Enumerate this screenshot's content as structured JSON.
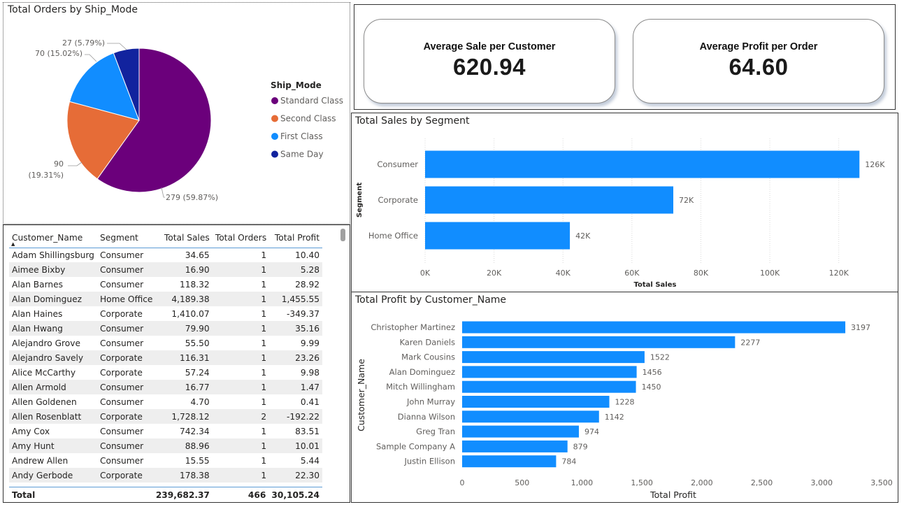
{
  "pie": {
    "title": "Total Orders by Ship_Mode",
    "legend_title": "Ship_Mode",
    "chart_data": {
      "type": "pie",
      "title": "Total Orders by Ship_Mode",
      "slices": [
        {
          "name": "Standard Class",
          "value": 279,
          "label": "279 (59.87%)",
          "color": "#6b007b"
        },
        {
          "name": "Second Class",
          "value": 90,
          "label": "90 (19.31%)",
          "color": "#e66c37"
        },
        {
          "name": "First Class",
          "value": 70,
          "label": "70 (15.02%)",
          "color": "#118dff"
        },
        {
          "name": "Same Day",
          "value": 27,
          "label": "27 (5.79%)",
          "color": "#12239e"
        }
      ]
    }
  },
  "cards": {
    "card1": {
      "label": "Average Sale per Customer",
      "value": "620.94"
    },
    "card2": {
      "label": "Average Profit per Order",
      "value": "64.60"
    }
  },
  "segment_chart": {
    "title": "Total Sales by Segment",
    "chart_data": {
      "type": "bar",
      "orientation": "horizontal",
      "title": "Total Sales by Segment",
      "xlabel": "Total Sales",
      "ylabel": "Segment",
      "categories": [
        "Consumer",
        "Corporate",
        "Home Office"
      ],
      "values": [
        126000,
        72000,
        42000
      ],
      "data_labels": [
        "126K",
        "72K",
        "42K"
      ],
      "xlim": [
        0,
        130000
      ],
      "xticks": [
        0,
        20000,
        40000,
        60000,
        80000,
        100000,
        120000
      ],
      "xtick_labels": [
        "0K",
        "20K",
        "40K",
        "60K",
        "80K",
        "100K",
        "120K"
      ],
      "color": "#118dff",
      "grid": true
    }
  },
  "profit_chart": {
    "title": "Total Profit by Customer_Name",
    "chart_data": {
      "type": "bar",
      "orientation": "horizontal",
      "title": "Total Profit by Customer_Name",
      "xlabel": "Total Profit",
      "ylabel": "Customer_Name",
      "categories": [
        "Christopher Martinez",
        "Karen Daniels",
        "Mark Cousins",
        "Alan Dominguez",
        "Mitch Willingham",
        "John Murray",
        "Dianna Wilson",
        "Greg Tran",
        "Sample Company A",
        "Justin Ellison"
      ],
      "values": [
        3197,
        2277,
        1522,
        1456,
        1450,
        1228,
        1142,
        974,
        879,
        784
      ],
      "data_labels": [
        "3197",
        "2277",
        "1522",
        "1456",
        "1450",
        "1228",
        "1142",
        "974",
        "879",
        "784"
      ],
      "xlim": [
        0,
        3500
      ],
      "xticks": [
        0,
        500,
        1000,
        1500,
        2000,
        2500,
        3000,
        3500
      ],
      "xtick_labels": [
        "0",
        "500",
        "1,000",
        "1,500",
        "2,000",
        "2,500",
        "3,000",
        "3,500"
      ],
      "color": "#118dff",
      "grid": false
    }
  },
  "table": {
    "columns": [
      "Customer_Name",
      "Segment",
      "Total Sales",
      "Total Orders",
      "Total Profit"
    ],
    "sort_indicator": "▲",
    "rows": [
      [
        "Adam Shillingsburg",
        "Consumer",
        "34.65",
        "1",
        "10.40"
      ],
      [
        "Aimee Bixby",
        "Consumer",
        "16.90",
        "1",
        "5.28"
      ],
      [
        "Alan Barnes",
        "Consumer",
        "118.32",
        "1",
        "28.92"
      ],
      [
        "Alan Dominguez",
        "Home Office",
        "4,189.38",
        "1",
        "1,455.55"
      ],
      [
        "Alan Haines",
        "Corporate",
        "1,410.07",
        "1",
        "-349.37"
      ],
      [
        "Alan Hwang",
        "Consumer",
        "79.90",
        "1",
        "35.16"
      ],
      [
        "Alejandro Grove",
        "Consumer",
        "55.50",
        "1",
        "9.99"
      ],
      [
        "Alejandro Savely",
        "Corporate",
        "116.31",
        "1",
        "23.26"
      ],
      [
        "Alice McCarthy",
        "Corporate",
        "57.24",
        "1",
        "9.98"
      ],
      [
        "Allen Armold",
        "Consumer",
        "16.77",
        "1",
        "1.47"
      ],
      [
        "Allen Goldenen",
        "Consumer",
        "4.70",
        "1",
        "0.41"
      ],
      [
        "Allen Rosenblatt",
        "Corporate",
        "1,728.12",
        "2",
        "-192.22"
      ],
      [
        "Amy Cox",
        "Consumer",
        "742.34",
        "1",
        "83.51"
      ],
      [
        "Amy Hunt",
        "Consumer",
        "88.96",
        "1",
        "10.01"
      ],
      [
        "Andrew Allen",
        "Consumer",
        "15.55",
        "1",
        "5.44"
      ],
      [
        "Andy Gerbode",
        "Corporate",
        "178.38",
        "1",
        "22.30"
      ]
    ],
    "total": {
      "label": "Total",
      "sales": "239,682.37",
      "orders": "466",
      "profit": "30,105.24"
    }
  }
}
